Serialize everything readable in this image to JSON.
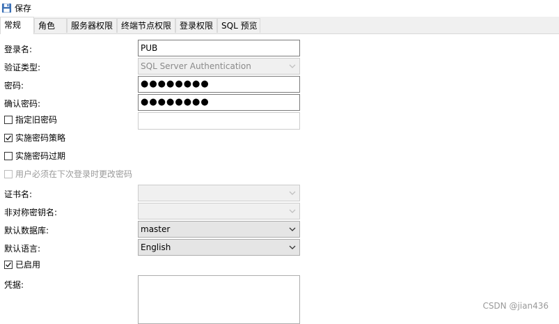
{
  "toolbar": {
    "save_label": "保存",
    "save_icon": "floppy-disk-icon"
  },
  "tabs": [
    {
      "label": "常规",
      "active": true
    },
    {
      "label": "角色"
    },
    {
      "label": "服务器权限"
    },
    {
      "label": "终端节点权限"
    },
    {
      "label": "登录权限"
    },
    {
      "label": "SQL 预览"
    }
  ],
  "form": {
    "login_name": {
      "label": "登录名:",
      "value": "PUB"
    },
    "auth_type": {
      "label": "验证类型:",
      "value": "SQL Server Authentication"
    },
    "password": {
      "label": "密码:",
      "value": "●●●●●●●●"
    },
    "confirm_password": {
      "label": "确认密码:",
      "value": "●●●●●●●●"
    },
    "specify_old_password": {
      "label": "指定旧密码",
      "checked": false
    },
    "enforce_policy": {
      "label": "实施密码策略",
      "checked": true
    },
    "enforce_expiration": {
      "label": "实施密码过期",
      "checked": false
    },
    "must_change": {
      "label": "用户必须在下次登录时更改密码",
      "checked": false,
      "disabled": true
    },
    "certificate": {
      "label": "证书名:",
      "value": ""
    },
    "asymmetric_key": {
      "label": "非对称密钥名:",
      "value": ""
    },
    "default_database": {
      "label": "默认数据库:",
      "value": "master"
    },
    "default_language": {
      "label": "默认语言:",
      "value": "English"
    },
    "enabled": {
      "label": "已启用",
      "checked": true
    },
    "credential": {
      "label": "凭据:"
    }
  },
  "watermark": "CSDN @jian436"
}
